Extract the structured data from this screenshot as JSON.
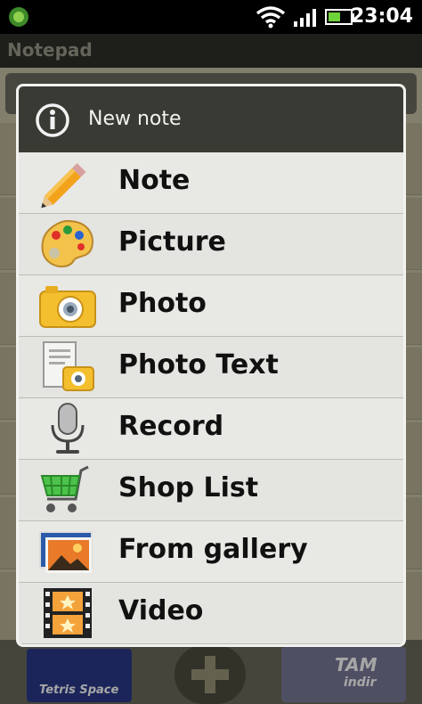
{
  "status_bar": {
    "time": "23:04",
    "icons": [
      "app-notification-icon",
      "wifi-icon",
      "signal-icon",
      "battery-icon"
    ]
  },
  "app": {
    "title": "Notepad",
    "bottom_bar": {
      "left_banner_text": "Tetris Space",
      "right_logo_line1": "TAM",
      "right_logo_line2": "indir"
    }
  },
  "dialog": {
    "title": "New note",
    "items": [
      {
        "label": "Note",
        "icon": "pencil-icon"
      },
      {
        "label": "Picture",
        "icon": "palette-icon"
      },
      {
        "label": "Photo",
        "icon": "camera-icon"
      },
      {
        "label": "Photo Text",
        "icon": "photo-text-icon"
      },
      {
        "label": "Record",
        "icon": "microphone-icon"
      },
      {
        "label": "Shop List",
        "icon": "shopping-cart-icon"
      },
      {
        "label": "From gallery",
        "icon": "gallery-icon"
      },
      {
        "label": "Video",
        "icon": "film-icon"
      }
    ]
  }
}
